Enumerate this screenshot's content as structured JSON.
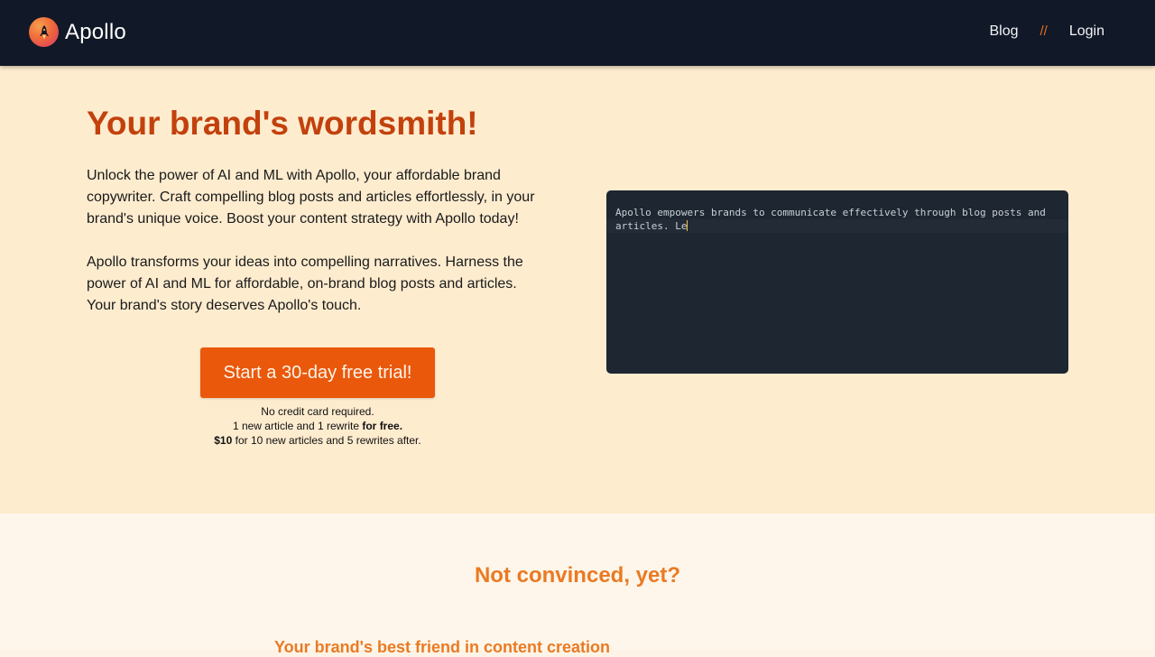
{
  "nav": {
    "brand": "Apollo",
    "separator": "//",
    "links": [
      "Blog",
      "Login"
    ],
    "logo_icon": "rocket-icon"
  },
  "hero": {
    "title": "Your brand's wordsmith!",
    "paragraph1": "Unlock the power of AI and ML with Apollo, your affordable brand copywriter. Craft compelling blog posts and articles effortlessly, in your brand's unique voice. Boost your content strategy with Apollo today!",
    "paragraph2": "Apollo transforms your ideas into compelling narratives. Harness the power of AI and ML for affordable, on-brand blog posts and articles. Your brand's story deserves Apollo's touch.",
    "cta_label": "Start a 30-day free trial!",
    "notes": {
      "line1": "No credit card required.",
      "line2_prefix": "1 new article and 1 rewrite",
      "line2_bold": "for free.",
      "line3_bold": "$10",
      "line3_suffix": "for 10 new articles and 5 rewrites after."
    },
    "terminal_text": "Apollo empowers brands to communicate effectively through blog posts and articles. Le"
  },
  "section2": {
    "title": "Not convinced, yet?",
    "subtitle": "Your brand's best friend in content creation"
  },
  "colors": {
    "nav_bg": "#111827",
    "accent": "#ea580c",
    "title": "#c2410c",
    "hero_bg": "#feeccf",
    "section_bg": "#fef6ea",
    "terminal_bg": "#1e2631"
  }
}
